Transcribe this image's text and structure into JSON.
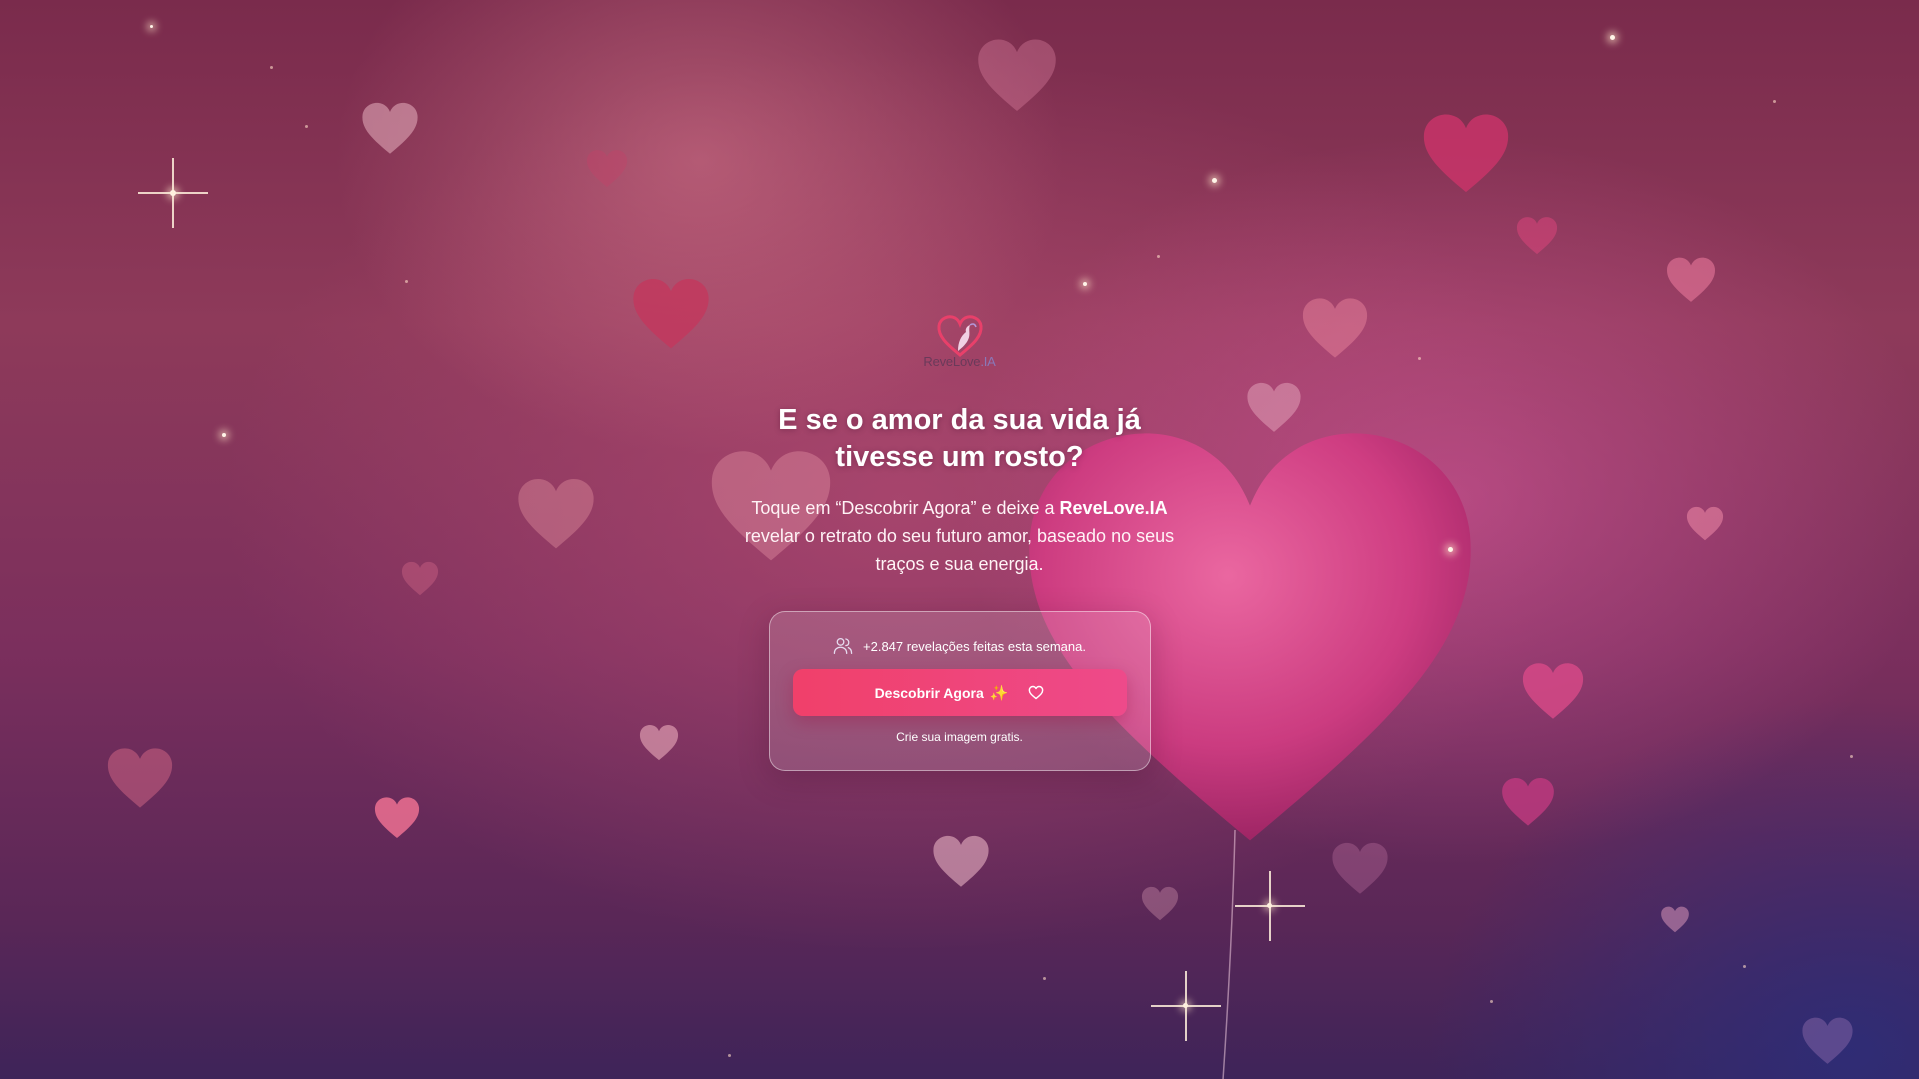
{
  "brand": {
    "logo_name": "ReveLove",
    "logo_suffix": ".IA"
  },
  "hero": {
    "headline": "E se o amor da sua vida já tivesse um rosto?",
    "subtext_before": "Toque em “Descobrir Agora” e deixe a ",
    "subtext_brand": "ReveLove.IA",
    "subtext_after": " revelar o retrato do seu futuro amor, baseado no seus traços e sua energia."
  },
  "card": {
    "stats_text": "+2.847 revelações feitas esta semana.",
    "cta_label": "Descobrir Agora",
    "cta_emoji": "✨",
    "footnote": "Crie sua imagem gratis."
  },
  "icons": {
    "stats": "users-icon",
    "cta": "heart-icon",
    "logo": "heart-logo-icon"
  },
  "colors": {
    "cta_start": "#f0406a",
    "cta_end": "#ee4a8a",
    "background_top": "#7a2b4c",
    "background_bottom": "#3e2459"
  }
}
